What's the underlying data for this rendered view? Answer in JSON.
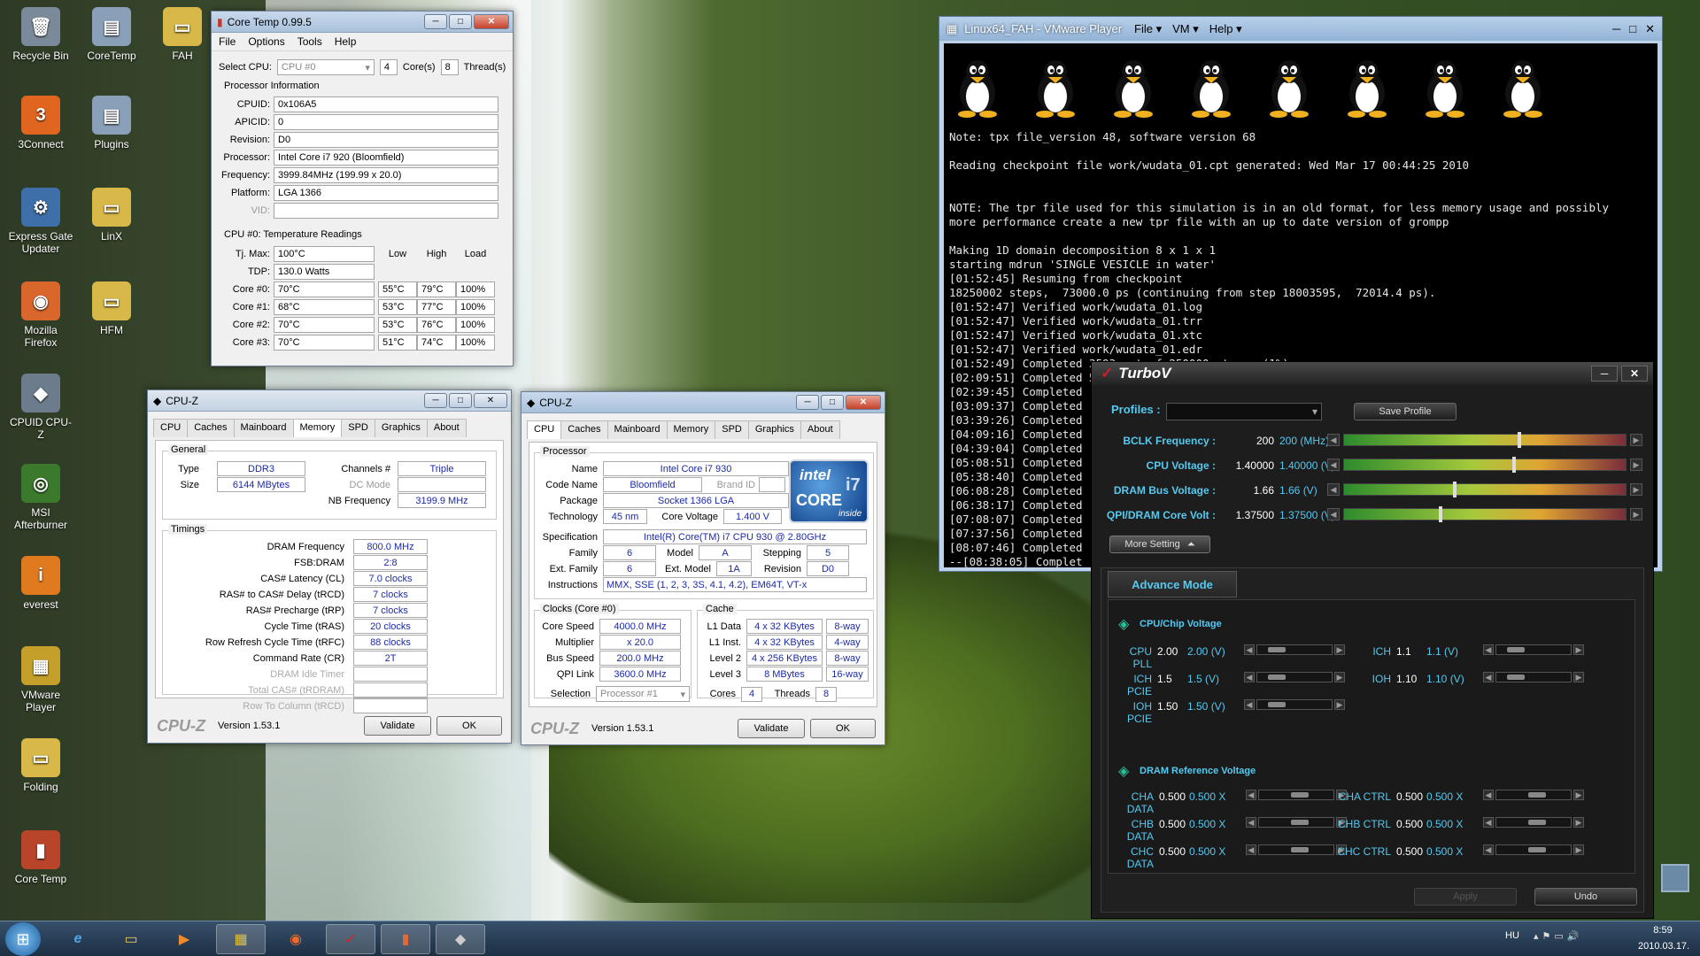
{
  "desktop": {
    "icons": [
      {
        "label": "Recycle Bin",
        "glyph": "🗑",
        "color": "#7a8a9a"
      },
      {
        "label": "CoreTemp",
        "glyph": "▤",
        "color": "#8aa0b8"
      },
      {
        "label": "FAH",
        "glyph": "▭",
        "color": "#d9b84a"
      },
      {
        "label": "3Connect",
        "glyph": "3",
        "color": "#e0661f"
      },
      {
        "label": "Plugins",
        "glyph": "▤",
        "color": "#8aa0b8"
      },
      {
        "label": "Express Gate Updater",
        "glyph": "⚙",
        "color": "#3e6fa8"
      },
      {
        "label": "LinX",
        "glyph": "▭",
        "color": "#d9b84a"
      },
      {
        "label": "Mozilla Firefox",
        "glyph": "◉",
        "color": "#d9662a"
      },
      {
        "label": "HFM",
        "glyph": "▭",
        "color": "#d9b84a"
      },
      {
        "label": "CPUID CPU-Z",
        "glyph": "◆",
        "color": "#6c7c8c"
      },
      {
        "label": "MSI Afterburner",
        "glyph": "◎",
        "color": "#3b7a2c"
      },
      {
        "label": "everest",
        "glyph": "i",
        "color": "#e07a1f"
      },
      {
        "label": "VMware Player",
        "glyph": "▦",
        "color": "#c4a02a"
      },
      {
        "label": "Folding",
        "glyph": "▭",
        "color": "#d9b84a"
      },
      {
        "label": "Core Temp",
        "glyph": "▮",
        "color": "#b8452a"
      }
    ]
  },
  "coretemp": {
    "title": "Core Temp 0.99.5",
    "menu": [
      "File",
      "Options",
      "Tools",
      "Help"
    ],
    "select_cpu_label": "Select CPU:",
    "select_cpu_value": "CPU #0",
    "cores_value": "4",
    "cores_label": "Core(s)",
    "threads_value": "8",
    "threads_label": "Thread(s)",
    "proc_info_label": "Processor Information",
    "info": [
      {
        "label": "CPUID:",
        "value": "0x106A5"
      },
      {
        "label": "APICID:",
        "value": "0"
      },
      {
        "label": "Revision:",
        "value": "D0"
      },
      {
        "label": "Processor:",
        "value": "Intel Core i7 920 (Bloomfield)"
      },
      {
        "label": "Frequency:",
        "value": "3999.84MHz (199.99 x 20.0)"
      },
      {
        "label": "Platform:",
        "value": "LGA 1366"
      },
      {
        "label": "VID:",
        "value": ""
      }
    ],
    "temp_label": "CPU #0: Temperature Readings",
    "tjmax_label": "Tj. Max:",
    "tjmax_value": "100°C",
    "col_low": "Low",
    "col_high": "High",
    "col_load": "Load",
    "tdp_label": "TDP:",
    "tdp_value": "130.0 Watts",
    "cores": [
      {
        "label": "Core #0:",
        "temp": "70°C",
        "low": "55°C",
        "high": "79°C",
        "load": "100%"
      },
      {
        "label": "Core #1:",
        "temp": "68°C",
        "low": "53°C",
        "high": "77°C",
        "load": "100%"
      },
      {
        "label": "Core #2:",
        "temp": "70°C",
        "low": "53°C",
        "high": "76°C",
        "load": "100%"
      },
      {
        "label": "Core #3:",
        "temp": "70°C",
        "low": "51°C",
        "high": "74°C",
        "load": "100%"
      }
    ]
  },
  "cpuz_mem": {
    "title": "CPU-Z",
    "tabs": [
      "CPU",
      "Caches",
      "Mainboard",
      "Memory",
      "SPD",
      "Graphics",
      "About"
    ],
    "active_tab": "Memory",
    "general_label": "General",
    "type_label": "Type",
    "type_value": "DDR3",
    "channels_label": "Channels #",
    "channels_value": "Triple",
    "size_label": "Size",
    "size_value": "6144 MBytes",
    "dcmode_label": "DC Mode",
    "nbfreq_label": "NB Frequency",
    "nbfreq_value": "3199.9 MHz",
    "timings_label": "Timings",
    "timings": [
      {
        "label": "DRAM Frequency",
        "value": "800.0 MHz",
        "dim": false
      },
      {
        "label": "FSB:DRAM",
        "value": "2:8",
        "dim": false
      },
      {
        "label": "CAS# Latency (CL)",
        "value": "7.0 clocks",
        "dim": false
      },
      {
        "label": "RAS# to CAS# Delay (tRCD)",
        "value": "7 clocks",
        "dim": false
      },
      {
        "label": "RAS# Precharge (tRP)",
        "value": "7 clocks",
        "dim": false
      },
      {
        "label": "Cycle Time (tRAS)",
        "value": "20 clocks",
        "dim": false
      },
      {
        "label": "Row Refresh Cycle Time (tRFC)",
        "value": "88 clocks",
        "dim": false
      },
      {
        "label": "Command Rate (CR)",
        "value": "2T",
        "dim": false
      },
      {
        "label": "DRAM Idle Timer",
        "value": "",
        "dim": true
      },
      {
        "label": "Total CAS# (tRDRAM)",
        "value": "",
        "dim": true
      },
      {
        "label": "Row To Column (tRCD)",
        "value": "",
        "dim": true
      }
    ],
    "brand": "CPU-Z",
    "version": "Version 1.53.1",
    "validate": "Validate",
    "ok": "OK"
  },
  "cpuz_cpu": {
    "title": "CPU-Z",
    "tabs": [
      "CPU",
      "Caches",
      "Mainboard",
      "Memory",
      "SPD",
      "Graphics",
      "About"
    ],
    "active_tab": "CPU",
    "processor_label": "Processor",
    "name_label": "Name",
    "name_value": "Intel Core i7 930",
    "codename_label": "Code Name",
    "codename_value": "Bloomfield",
    "brandid_label": "Brand ID",
    "package_label": "Package",
    "package_value": "Socket 1366 LGA",
    "tech_label": "Technology",
    "tech_value": "45 nm",
    "corevolt_label": "Core Voltage",
    "corevolt_value": "1.400 V",
    "spec_label": "Specification",
    "spec_value": "Intel(R) Core(TM) i7 CPU        930  @ 2.80GHz",
    "family_label": "Family",
    "family_value": "6",
    "model_label": "Model",
    "model_value": "A",
    "stepping_label": "Stepping",
    "stepping_value": "5",
    "extfamily_label": "Ext. Family",
    "extfamily_value": "6",
    "extmodel_label": "Ext. Model",
    "extmodel_value": "1A",
    "revision_label": "Revision",
    "revision_value": "D0",
    "instr_label": "Instructions",
    "instr_value": "MMX, SSE (1, 2, 3, 3S, 4.1, 4.2), EM64T, VT-x",
    "clocks_label": "Clocks (Core #0)",
    "corespeed_label": "Core Speed",
    "corespeed_value": "4000.0 MHz",
    "mult_label": "Multiplier",
    "mult_value": "x 20.0",
    "busspeed_label": "Bus Speed",
    "busspeed_value": "200.0 MHz",
    "qpi_label": "QPI Link",
    "qpi_value": "3600.0 MHz",
    "cache_label": "Cache",
    "caches": [
      {
        "label": "L1 Data",
        "size": "4 x 32 KBytes",
        "way": "8-way"
      },
      {
        "label": "L1 Inst.",
        "size": "4 x 32 KBytes",
        "way": "4-way"
      },
      {
        "label": "Level 2",
        "size": "4 x 256 KBytes",
        "way": "8-way"
      },
      {
        "label": "Level 3",
        "size": "8 MBytes",
        "way": "16-way"
      }
    ],
    "selection_label": "Selection",
    "selection_value": "Processor #1",
    "cores_label": "Cores",
    "cores_value": "4",
    "threads_label": "Threads",
    "threads_value": "8",
    "intel_logo": "intel",
    "intel_core": "CORE",
    "intel_i7": "i7",
    "intel_inside": "inside",
    "brand": "CPU-Z",
    "version": "Version 1.53.1",
    "validate": "Validate",
    "ok": "OK"
  },
  "vmware": {
    "title": "Linux64_FAH - VMware Player",
    "menu": [
      "File",
      "VM",
      "Help"
    ],
    "lines": [
      "Note: tpx file_version 48, software version 68",
      "",
      "Reading checkpoint file work/wudata_01.cpt generated: Wed Mar 17 00:44:25 2010",
      "",
      "",
      "NOTE: The tpr file used for this simulation is in an old format, for less memory usage and possibly",
      "more performance create a new tpr file with an up to date version of grompp",
      "",
      "Making 1D domain decomposition 8 x 1 x 1",
      "starting mdrun 'SINGLE VESICLE in water'",
      "[01:52:45] Resuming from checkpoint",
      "18250002 steps,  73000.0 ps (continuing from step 18003595,  72014.4 ps).",
      "[01:52:47] Verified work/wudata_01.log",
      "[01:52:47] Verified work/wudata_01.trr",
      "[01:52:47] Verified work/wudata_01.xtc",
      "[01:52:47] Verified work/wudata_01.edr",
      "[01:52:49] Completed 3593 out of 250000 steps  (1%)",
      "[02:09:51] Completed 5000 out of 250000 steps  (2%)",
      "[02:39:45] Completed",
      "[03:09:37] Completed",
      "[03:39:26] Completed",
      "[04:09:16] Completed",
      "[04:39:04] Completed",
      "[05:08:51] Completed",
      "[05:38:40] Completed",
      "[06:08:28] Completed",
      "[06:38:17] Completed",
      "[07:08:07] Completed",
      "[07:37:56] Completed",
      "[08:07:46] Completed",
      "--[08:38:05] Complet",
      "_"
    ]
  },
  "turbov": {
    "title": "TurboV",
    "profiles_label": "Profiles :",
    "save_profile": "Save Profile",
    "sliders": [
      {
        "label": "BCLK Frequency :",
        "current": "200",
        "target": "200 (MHz)",
        "level": 0.62
      },
      {
        "label": "CPU Voltage :",
        "current": "1.40000",
        "target": "1.40000 (V)",
        "level": 0.6
      },
      {
        "label": "DRAM Bus Voltage :",
        "current": "1.66",
        "target": "1.66 (V)",
        "level": 0.39
      },
      {
        "label": "QPI/DRAM Core Volt :",
        "current": "1.37500",
        "target": "1.37500 (V)",
        "level": 0.34
      }
    ],
    "more_setting": "More Setting",
    "advance_mode": "Advance Mode",
    "chip_label": "CPU/Chip Voltage",
    "chip_left": [
      {
        "label": "CPU PLL",
        "current": "2.00",
        "target": "2.00 (V)"
      },
      {
        "label": "ICH PCIE",
        "current": "1.5",
        "target": "1.5 (V)"
      },
      {
        "label": "IOH PCIE",
        "current": "1.50",
        "target": "1.50 (V)"
      }
    ],
    "chip_right": [
      {
        "label": "ICH",
        "current": "1.1",
        "target": "1.1 (V)"
      },
      {
        "label": "IOH",
        "current": "1.10",
        "target": "1.10 (V)"
      }
    ],
    "dram_label": "DRAM Reference Voltage",
    "dram_left": [
      {
        "label": "CHA DATA",
        "current": "0.500",
        "target": "0.500 X"
      },
      {
        "label": "CHB DATA",
        "current": "0.500",
        "target": "0.500 X"
      },
      {
        "label": "CHC DATA",
        "current": "0.500",
        "target": "0.500 X"
      }
    ],
    "dram_right": [
      {
        "label": "CHA CTRL",
        "current": "0.500",
        "target": "0.500 X"
      },
      {
        "label": "CHB CTRL",
        "current": "0.500",
        "target": "0.500 X"
      },
      {
        "label": "CHC CTRL",
        "current": "0.500",
        "target": "0.500 X"
      }
    ],
    "apply": "Apply",
    "undo": "Undo"
  },
  "taskbar": {
    "lang": "HU",
    "time": "8:59",
    "date": "2010.03.17."
  }
}
